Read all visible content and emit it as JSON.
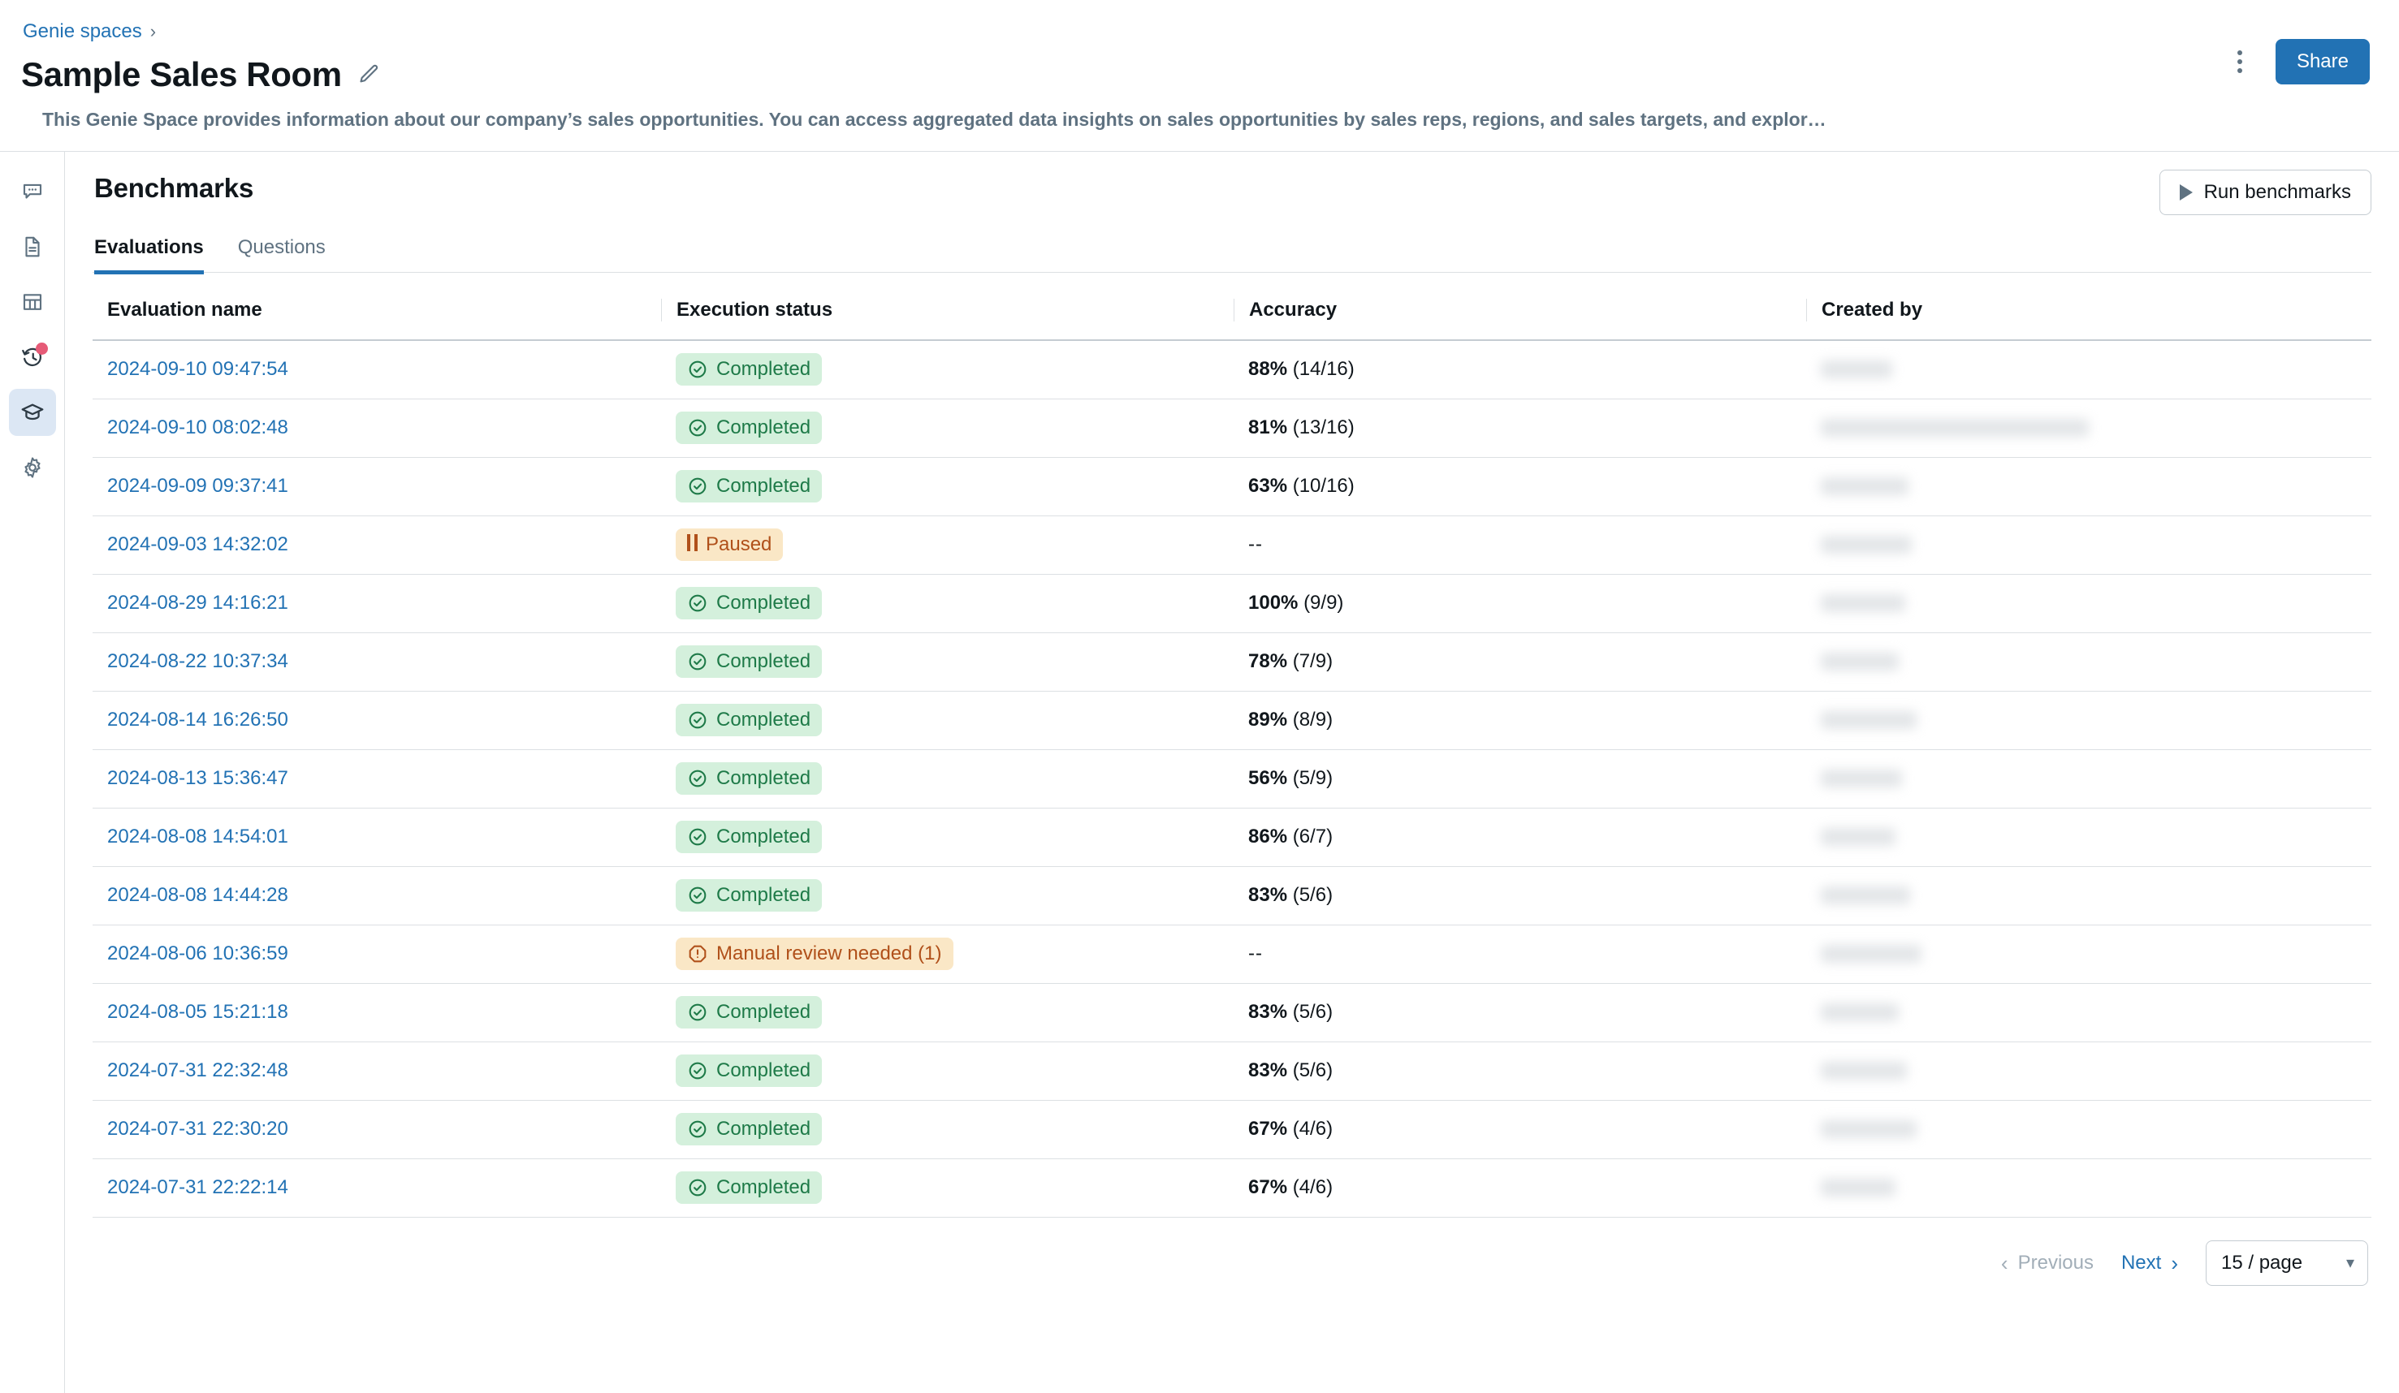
{
  "header": {
    "breadcrumb_label": "Genie spaces",
    "breadcrumb_separator": "›",
    "title": "Sample Sales Room",
    "edit_icon": "pencil-icon",
    "description": "This Genie Space provides information about our company’s sales opportunities. You can access aggregated data insights on sales opportunities by sales reps, regions, and sales targets, and explor…",
    "more_icon": "kebab-menu-icon",
    "share_label": "Share"
  },
  "sidebar": {
    "items": [
      {
        "icon": "chat-bubble-icon",
        "active": false,
        "badge": false
      },
      {
        "icon": "document-icon",
        "active": false,
        "badge": false
      },
      {
        "icon": "table-icon",
        "active": false,
        "badge": false
      },
      {
        "icon": "history-icon",
        "active": false,
        "badge": true
      },
      {
        "icon": "graduation-cap-icon",
        "active": true,
        "badge": false
      },
      {
        "icon": "gear-icon",
        "active": false,
        "badge": false
      }
    ]
  },
  "main": {
    "section_title": "Benchmarks",
    "run_button_label": "Run benchmarks",
    "run_button_icon": "play-icon",
    "tabs": [
      {
        "label": "Evaluations",
        "active": true
      },
      {
        "label": "Questions",
        "active": false
      }
    ]
  },
  "table": {
    "columns": [
      "Evaluation name",
      "Execution status",
      "Accuracy",
      "Created by"
    ],
    "rows": [
      {
        "name": "2024-09-10 09:47:54",
        "status": "Completed",
        "status_type": "completed",
        "status_icon": "check-circle-icon",
        "accuracy_pct": "88%",
        "accuracy_frac": "(14/16)",
        "created_by": ""
      },
      {
        "name": "2024-09-10 08:02:48",
        "status": "Completed",
        "status_type": "completed",
        "status_icon": "check-circle-icon",
        "accuracy_pct": "81%",
        "accuracy_frac": "(13/16)",
        "created_by": ""
      },
      {
        "name": "2024-09-09 09:37:41",
        "status": "Completed",
        "status_type": "completed",
        "status_icon": "check-circle-icon",
        "accuracy_pct": "63%",
        "accuracy_frac": "(10/16)",
        "created_by": ""
      },
      {
        "name": "2024-09-03 14:32:02",
        "status": "Paused",
        "status_type": "paused",
        "status_icon": "pause-icon",
        "accuracy_pct": "--",
        "accuracy_frac": "",
        "created_by": ""
      },
      {
        "name": "2024-08-29 14:16:21",
        "status": "Completed",
        "status_type": "completed",
        "status_icon": "check-circle-icon",
        "accuracy_pct": "100%",
        "accuracy_frac": "(9/9)",
        "created_by": ""
      },
      {
        "name": "2024-08-22 10:37:34",
        "status": "Completed",
        "status_type": "completed",
        "status_icon": "check-circle-icon",
        "accuracy_pct": "78%",
        "accuracy_frac": "(7/9)",
        "created_by": ""
      },
      {
        "name": "2024-08-14 16:26:50",
        "status": "Completed",
        "status_type": "completed",
        "status_icon": "check-circle-icon",
        "accuracy_pct": "89%",
        "accuracy_frac": "(8/9)",
        "created_by": ""
      },
      {
        "name": "2024-08-13 15:36:47",
        "status": "Completed",
        "status_type": "completed",
        "status_icon": "check-circle-icon",
        "accuracy_pct": "56%",
        "accuracy_frac": "(5/9)",
        "created_by": ""
      },
      {
        "name": "2024-08-08 14:54:01",
        "status": "Completed",
        "status_type": "completed",
        "status_icon": "check-circle-icon",
        "accuracy_pct": "86%",
        "accuracy_frac": "(6/7)",
        "created_by": ""
      },
      {
        "name": "2024-08-08 14:44:28",
        "status": "Completed",
        "status_type": "completed",
        "status_icon": "check-circle-icon",
        "accuracy_pct": "83%",
        "accuracy_frac": "(5/6)",
        "created_by": ""
      },
      {
        "name": "2024-08-06 10:36:59",
        "status": "Manual review needed (1)",
        "status_type": "review",
        "status_icon": "warning-octagon-icon",
        "accuracy_pct": "--",
        "accuracy_frac": "",
        "created_by": ""
      },
      {
        "name": "2024-08-05 15:21:18",
        "status": "Completed",
        "status_type": "completed",
        "status_icon": "check-circle-icon",
        "accuracy_pct": "83%",
        "accuracy_frac": "(5/6)",
        "created_by": ""
      },
      {
        "name": "2024-07-31 22:32:48",
        "status": "Completed",
        "status_type": "completed",
        "status_icon": "check-circle-icon",
        "accuracy_pct": "83%",
        "accuracy_frac": "(5/6)",
        "created_by": ""
      },
      {
        "name": "2024-07-31 22:30:20",
        "status": "Completed",
        "status_type": "completed",
        "status_icon": "check-circle-icon",
        "accuracy_pct": "67%",
        "accuracy_frac": "(4/6)",
        "created_by": ""
      },
      {
        "name": "2024-07-31 22:22:14",
        "status": "Completed",
        "status_type": "completed",
        "status_icon": "check-circle-icon",
        "accuracy_pct": "67%",
        "accuracy_frac": "(4/6)",
        "created_by": ""
      }
    ]
  },
  "pagination": {
    "previous_label": "Previous",
    "next_label": "Next",
    "prev_icon": "chevron-left-icon",
    "next_icon": "chevron-right-icon",
    "page_size_label": "15 / page",
    "page_size_caret": "chevron-down-icon"
  },
  "colors": {
    "link": "#2272B4",
    "primary_button": "#2272B4",
    "success_bg": "#D4F0DC",
    "success_fg": "#1E7A48",
    "warning_bg": "#FAE7C6",
    "warning_fg": "#B0501A",
    "badge_dot": "#E65B77",
    "border": "#DCE0E3",
    "muted_text": "#5F7281"
  }
}
